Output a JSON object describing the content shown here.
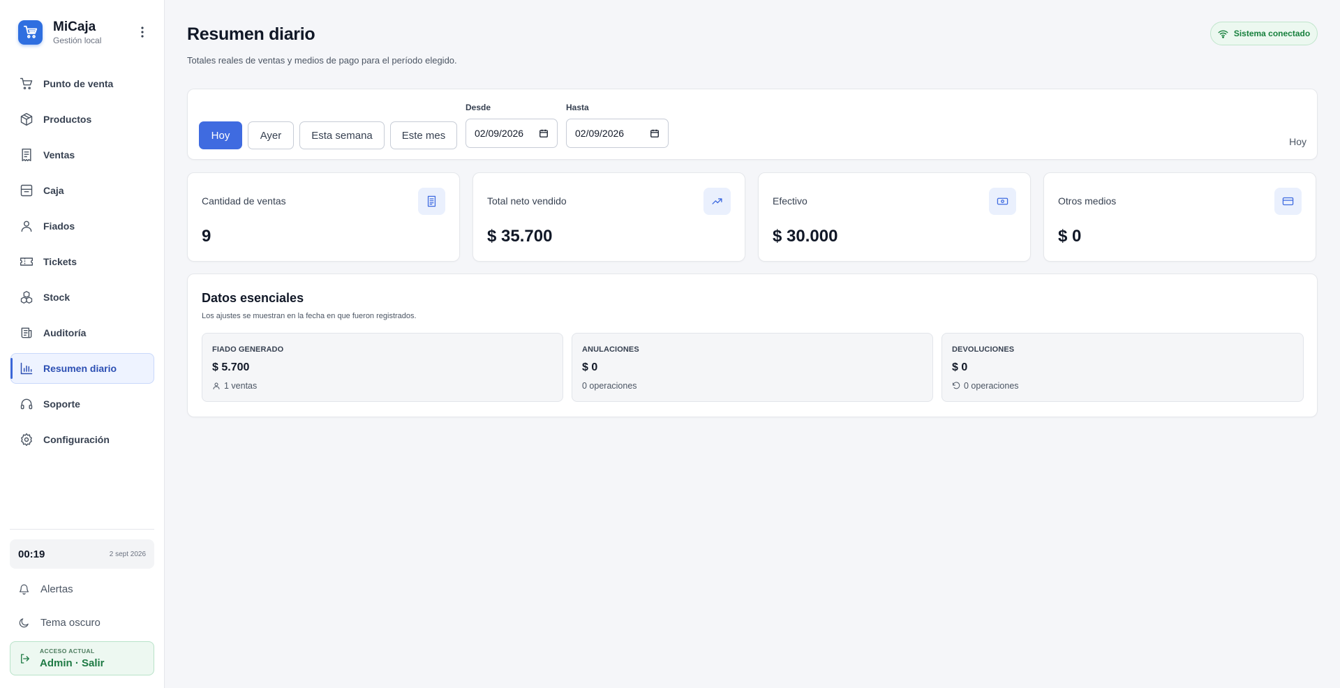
{
  "brand": {
    "name": "MiCaja",
    "subtitle": "Gestión local"
  },
  "sidebar": {
    "items": [
      {
        "label": "Punto de venta",
        "icon": "cart-icon"
      },
      {
        "label": "Productos",
        "icon": "box-icon"
      },
      {
        "label": "Ventas",
        "icon": "receipt-icon"
      },
      {
        "label": "Caja",
        "icon": "cash-drawer-icon"
      },
      {
        "label": "Fiados",
        "icon": "user-icon"
      },
      {
        "label": "Tickets",
        "icon": "ticket-icon"
      },
      {
        "label": "Stock",
        "icon": "boxes-icon"
      },
      {
        "label": "Auditoría",
        "icon": "audit-icon"
      },
      {
        "label": "Resumen diario",
        "icon": "bar-chart-icon",
        "active": true
      },
      {
        "label": "Soporte",
        "icon": "headset-icon"
      },
      {
        "label": "Configuración",
        "icon": "gear-icon"
      }
    ],
    "clock": {
      "time": "00:19",
      "date": "2 sept 2026"
    },
    "alerts_label": "Alertas",
    "theme_label": "Tema oscuro",
    "access": {
      "label": "ACCESO ACTUAL",
      "user": "Admin · Salir"
    }
  },
  "header": {
    "title": "Resumen diario",
    "subtitle": "Totales reales de ventas y medios de pago para el período elegido.",
    "status": "Sistema conectado"
  },
  "filters": {
    "ranges": [
      {
        "label": "Hoy",
        "active": true
      },
      {
        "label": "Ayer"
      },
      {
        "label": "Esta semana"
      },
      {
        "label": "Este mes"
      }
    ],
    "from_label": "Desde",
    "from_value": "02/09/2026",
    "to_label": "Hasta",
    "to_value": "02/09/2026",
    "period_label": "Hoy"
  },
  "stats": [
    {
      "label": "Cantidad de ventas",
      "value": "9",
      "icon": "document-icon"
    },
    {
      "label": "Total neto vendido",
      "value": "$ 35.700",
      "icon": "trend-up-icon"
    },
    {
      "label": "Efectivo",
      "value": "$ 30.000",
      "icon": "banknote-icon"
    },
    {
      "label": "Otros medios",
      "value": "$ 0",
      "icon": "credit-card-icon"
    }
  ],
  "essentials": {
    "title": "Datos esenciales",
    "subtitle": "Los ajustes se muestran en la fecha en que fueron registrados.",
    "boxes": [
      {
        "label": "FIADO GENERADO",
        "value": "$ 5.700",
        "foot": "1 ventas",
        "icon": "user-icon"
      },
      {
        "label": "ANULACIONES",
        "value": "$ 0",
        "foot": "0 operaciones",
        "icon": ""
      },
      {
        "label": "DEVOLUCIONES",
        "value": "$ 0",
        "foot": "0 operaciones",
        "icon": "undo-icon"
      }
    ]
  },
  "colors": {
    "accent": "#3f6be0",
    "success": "#17803d",
    "active_nav_bg": "#eef3ff"
  }
}
